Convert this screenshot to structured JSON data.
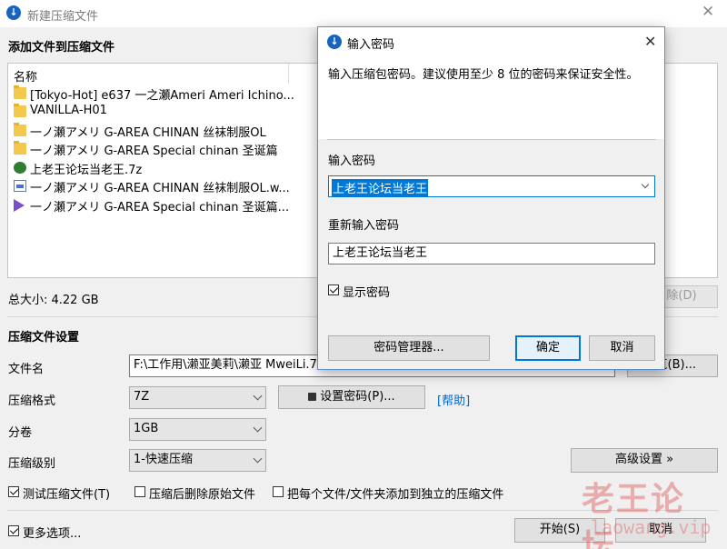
{
  "window": {
    "title": "新建压缩文件",
    "close_glyph": "✕"
  },
  "add_files": {
    "heading": "添加文件到压缩文件",
    "column_name": "名称",
    "files": [
      {
        "name": "[Tokyo-Hot] e637 一之瀬Ameri Ameri Ichino...",
        "icon": "folder-icon"
      },
      {
        "name": "VANILLA-H01",
        "icon": "folder-icon"
      },
      {
        "name": "一ノ瀬アメリ G-AREA CHINAN 丝袜制服OL",
        "icon": "folder-icon"
      },
      {
        "name": "一ノ瀬アメリ G-AREA Special chinan 圣诞篇",
        "icon": "folder-icon"
      },
      {
        "name": "上老王论坛当老王.7z",
        "icon": "archive-icon"
      },
      {
        "name": "一ノ瀬アメリ G-AREA CHINAN 丝袜制服OL.w...",
        "icon": "document-icon"
      },
      {
        "name": "一ノ瀬アメリ G-AREA Special chinan 圣诞篇...",
        "icon": "video-icon"
      }
    ],
    "total_size": "总大小: 4.22 GB",
    "delete_button": "除(D)"
  },
  "settings": {
    "heading": "压缩文件设置",
    "filename_label": "文件名",
    "filename_value": "F:\\工作用\\濑亚美莉\\濑亚 MweiLi.7z",
    "browse_button": "览(B)...",
    "format_label": "压缩格式",
    "format_value": "7Z",
    "set_password_button": "设置密码(P)...",
    "help_link": "[帮助]",
    "split_label": "分卷",
    "split_value": "1GB",
    "level_label": "压缩级别",
    "level_value": "1-快速压缩",
    "advanced_button": "高级设置 »",
    "test_archive_label": "测试压缩文件(T)",
    "test_archive_checked": true,
    "delete_source_label": "压缩后删除原始文件",
    "delete_source_checked": false,
    "separate_archives_label": "把每个文件/文件夹添加到独立的压缩文件",
    "separate_archives_checked": false
  },
  "footer": {
    "more_options_label": "更多选项...",
    "more_options_checked": true,
    "start_button": "开始(S)",
    "cancel_button": "取消"
  },
  "watermark": {
    "line1": "老王论坛",
    "line2": "laowang.vip"
  },
  "password_dialog": {
    "title": "输入密码",
    "close_glyph": "✕",
    "description": "输入压缩包密码。建议使用至少 8 位的密码来保证安全性。",
    "password_label": "输入密码",
    "password_value": "上老王论坛当老王",
    "reenter_label": "重新输入密码",
    "reenter_value": "上老王论坛当老王",
    "show_password_label": "显示密码",
    "show_password_checked": true,
    "manager_button": "密码管理器...",
    "ok_button": "确定",
    "cancel_button": "取消"
  },
  "colors": {
    "accent": "#0078d7",
    "link": "#0066cc",
    "watermark": "#e05a5a"
  }
}
